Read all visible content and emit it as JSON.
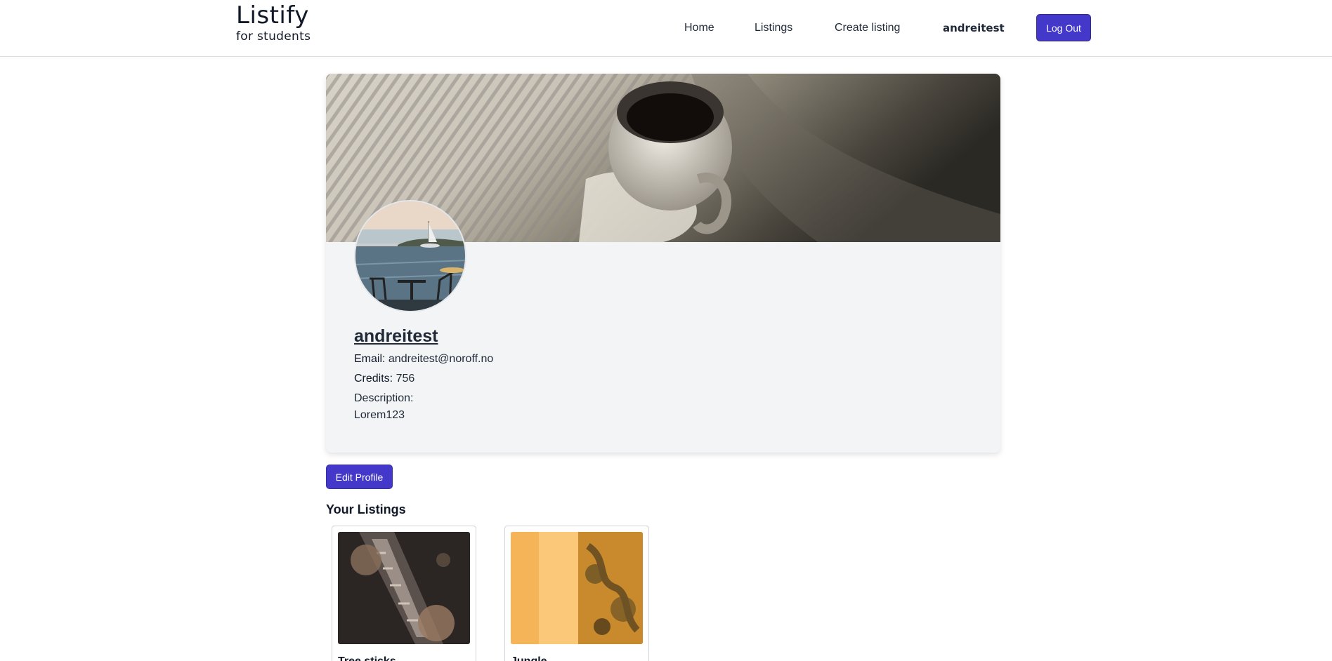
{
  "header": {
    "logo_title": "Listify",
    "logo_subtitle": "for students",
    "nav": {
      "home": "Home",
      "listings": "Listings",
      "create_listing": "Create listing",
      "username": "andreitest"
    },
    "logout_label": "Log Out"
  },
  "profile": {
    "name": "andreitest",
    "email_label": "Email:",
    "email": "andreitest@noroff.no",
    "credits_label": "Credits:",
    "credits": "756",
    "description_label": "Description:",
    "description": "Lorem123"
  },
  "actions": {
    "edit_profile_label": "Edit Profile"
  },
  "listings_section": {
    "title": "Your Listings",
    "items": [
      {
        "title": "Tree sticks"
      },
      {
        "title": "Jungle"
      }
    ]
  },
  "colors": {
    "accent": "#4338ca",
    "card_bg": "#f3f4f6",
    "text": "#1f2937"
  }
}
